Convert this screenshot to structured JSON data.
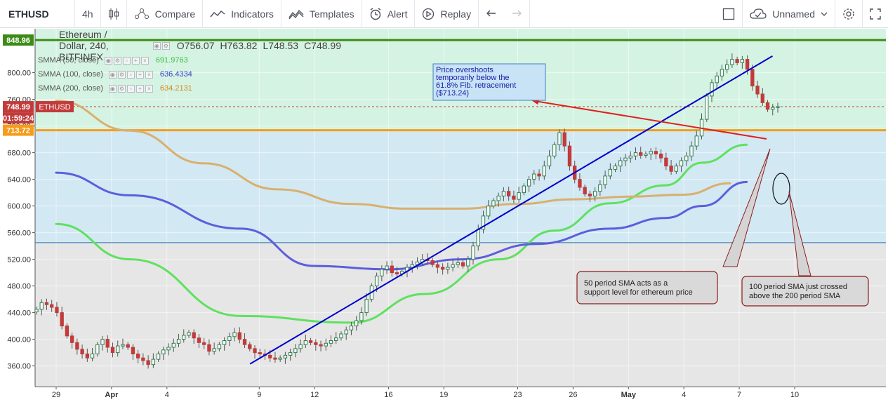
{
  "toolbar": {
    "symbol": "ETHUSD",
    "interval": "4h",
    "compare_label": "Compare",
    "indicators_label": "Indicators",
    "templates_label": "Templates",
    "alert_label": "Alert",
    "replay_label": "Replay",
    "layout_name": "Unnamed",
    "icons": [
      "candles-icon",
      "compare-icon",
      "indicators-icon",
      "templates-icon",
      "alert-icon",
      "replay-icon",
      "undo-icon",
      "redo-icon",
      "layout-square-icon",
      "cloud-icon",
      "chevron-down-icon",
      "gear-icon",
      "fullscreen-icon"
    ]
  },
  "legend": {
    "title": "Ethereum / Dollar, 240, BITFINEX",
    "open": "O756.07",
    "high": "H763.82",
    "low": "L748.53",
    "close": "C748.99",
    "sma50_label": "SMMA (50, close)",
    "sma50_value": "691.9763",
    "sma100_label": "SMMA (100, close)",
    "sma100_value": "636.4334",
    "sma200_label": "SMMA (200, close)",
    "sma200_value": "634.2131"
  },
  "price_labels": {
    "top_line": "848.96",
    "last_price": "748.99",
    "last_symbol": "ETHUSD",
    "countdown": "01:59:24",
    "fib": "713.72"
  },
  "colors": {
    "sma50": "#5fe15f",
    "sma100": "#5b5fdc",
    "sma200": "#d8b06e",
    "fib_line": "#f59c1a",
    "top_line": "#3d8b17",
    "trendline": "#0000cc",
    "arrow": "#e02020",
    "up_candle": "#2e7d4f",
    "down_candle": "#c23b3b",
    "zone_green": "#d5f3e3",
    "zone_blue": "#d2e8f3",
    "zone_gray": "#e6e6e6",
    "last_price_bg": "#c23b3b",
    "fib_bg": "#f59c1a",
    "top_bg": "#3d8b17"
  },
  "annotations": {
    "overshoot": [
      "Price overshoots",
      "temporarily below the",
      "61.8% Fib. retracement",
      "($713.24)"
    ],
    "sma50_note": [
      "50 period SMA acts as a",
      "support level for ethereum price"
    ],
    "sma_cross_note": [
      "100 period SMA just crossed",
      "above the 200 period SMA"
    ]
  },
  "chart_data": {
    "type": "candlestick",
    "title": "Ethereum / Dollar, 240, BITFINEX",
    "xlabel": "",
    "ylabel": "",
    "ylim": [
      340,
      852
    ],
    "y_ticks": [
      "360.00",
      "400.00",
      "440.00",
      "480.00",
      "520.00",
      "560.00",
      "600.00",
      "640.00",
      "680.00",
      "720.00",
      "760.00",
      "800.00"
    ],
    "x_ticks": [
      "29",
      "Apr",
      "4",
      "9",
      "12",
      "16",
      "19",
      "23",
      "26",
      "May",
      "4",
      "7",
      "10"
    ],
    "x_tick_day_index": [
      0,
      3,
      6,
      11,
      14,
      18,
      21,
      25,
      28,
      31,
      34,
      37,
      40
    ],
    "horizontal_levels": [
      {
        "name": "top",
        "value": 848.96
      },
      {
        "name": "fib",
        "value": 713.72
      },
      {
        "name": "last",
        "value": 748.99
      },
      {
        "name": "zone_low",
        "value": 545
      }
    ],
    "closes": [
      445,
      455,
      452,
      448,
      440,
      420,
      405,
      395,
      385,
      378,
      372,
      378,
      392,
      400,
      388,
      380,
      390,
      392,
      388,
      378,
      372,
      368,
      362,
      370,
      378,
      384,
      388,
      394,
      400,
      406,
      410,
      402,
      395,
      392,
      382,
      386,
      392,
      398,
      404,
      410,
      400,
      392,
      386,
      380,
      378,
      376,
      372,
      370,
      372,
      376,
      380,
      386,
      392,
      398,
      395,
      392,
      390,
      394,
      398,
      402,
      408,
      414,
      420,
      428,
      440,
      460,
      480,
      495,
      505,
      510,
      500,
      498,
      502,
      508,
      512,
      516,
      520,
      518,
      512,
      508,
      505,
      508,
      512,
      515,
      510,
      520,
      540,
      565,
      585,
      600,
      608,
      615,
      622,
      615,
      610,
      620,
      630,
      640,
      648,
      645,
      660,
      675,
      692,
      710,
      690,
      660,
      640,
      628,
      618,
      615,
      622,
      632,
      645,
      655,
      660,
      668,
      672,
      675,
      680,
      676,
      678,
      682,
      678,
      672,
      660,
      652,
      660,
      668,
      675,
      690,
      705,
      730,
      765,
      785,
      795,
      805,
      812,
      820,
      815,
      820,
      805,
      780,
      768,
      755,
      745,
      748,
      749
    ],
    "series": [
      {
        "name": "SMMA (50, close)",
        "x": [
          0,
          4,
          10,
          16,
          20,
          24,
          27,
          30,
          33,
          35,
          37.4
        ],
        "y": [
          573,
          520,
          435,
          425,
          468,
          520,
          563,
          604,
          631,
          665,
          692
        ]
      },
      {
        "name": "SMMA (100, close)",
        "x": [
          0,
          4,
          10,
          14,
          18,
          22,
          26,
          30,
          33,
          35,
          37.4
        ],
        "y": [
          650,
          616,
          566,
          510,
          505,
          520,
          543,
          566,
          582,
          600,
          636
        ]
      },
      {
        "name": "SMMA (200, close)",
        "x": [
          0,
          4,
          8,
          12,
          16,
          19,
          22,
          25,
          28,
          31,
          34,
          36.5
        ],
        "y": [
          758,
          713,
          664,
          625,
          603,
          596,
          596,
          603,
          610,
          614,
          617,
          634
        ]
      }
    ],
    "trendline": {
      "x": [
        10.5,
        38.8
      ],
      "y": [
        363,
        825
      ]
    }
  }
}
